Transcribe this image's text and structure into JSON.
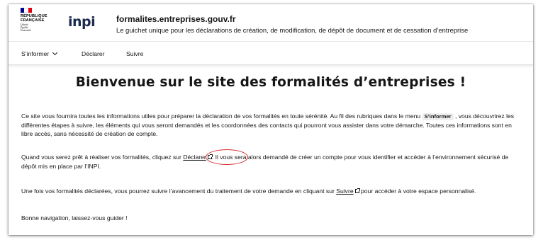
{
  "header": {
    "rf_lines": [
      "RÉPUBLIQUE",
      "FRANÇAISE"
    ],
    "motto_lines": [
      "Liberté",
      "Égalité",
      "Fraternité"
    ],
    "brand": "inpi",
    "site_title": "formalites.entreprises.gouv.fr",
    "tagline": "Le guichet unique pour les déclarations de création, de modification, de dépôt de document et de cessation d’entreprise",
    "flag_colors": [
      "#000091",
      "#ffffff",
      "#e1000f"
    ]
  },
  "nav": {
    "items": [
      {
        "label": "S’informer",
        "has_dropdown": true
      },
      {
        "label": "Déclarer",
        "has_dropdown": false
      },
      {
        "label": "Suivre",
        "has_dropdown": false
      }
    ]
  },
  "main": {
    "title": "Bienvenue sur le site des formalités d’entreprises !",
    "p1": {
      "before": "Ce site vous fournira toutes les informations utiles pour préparer la déclaration de vos formalités en toute sérénité. Au fil des rubriques dans le menu ",
      "tag": "S’informer",
      "after": " , vous découvrirez les différentes étapes à suivre, les éléments qui vous seront demandés et les coordonnées des contacts qui pourront vous assister dans votre démarche. Toutes ces informations sont en libre accès, sans nécessité de création de compte."
    },
    "p2": {
      "before": "Quand vous serez prêt à réaliser vos formalités, cliquez sur ",
      "link": "Déclarer",
      "after": ". Il vous sera alors demandé de créer un compte pour vous identifier et accéder à l’environnement sécurisé de dépôt mis en place par l’INPI."
    },
    "p3": {
      "before": "Une fois vos formalités déclarées, vous pourrez suivre l’avancement du traitement de votre demande en cliquant sur ",
      "link": "Suivre",
      "after": " pour accéder à votre espace personnalisé."
    },
    "p4": "Bonne navigation, laissez-vous guider !"
  },
  "annotation": {
    "ring_color": "#d9262b"
  }
}
